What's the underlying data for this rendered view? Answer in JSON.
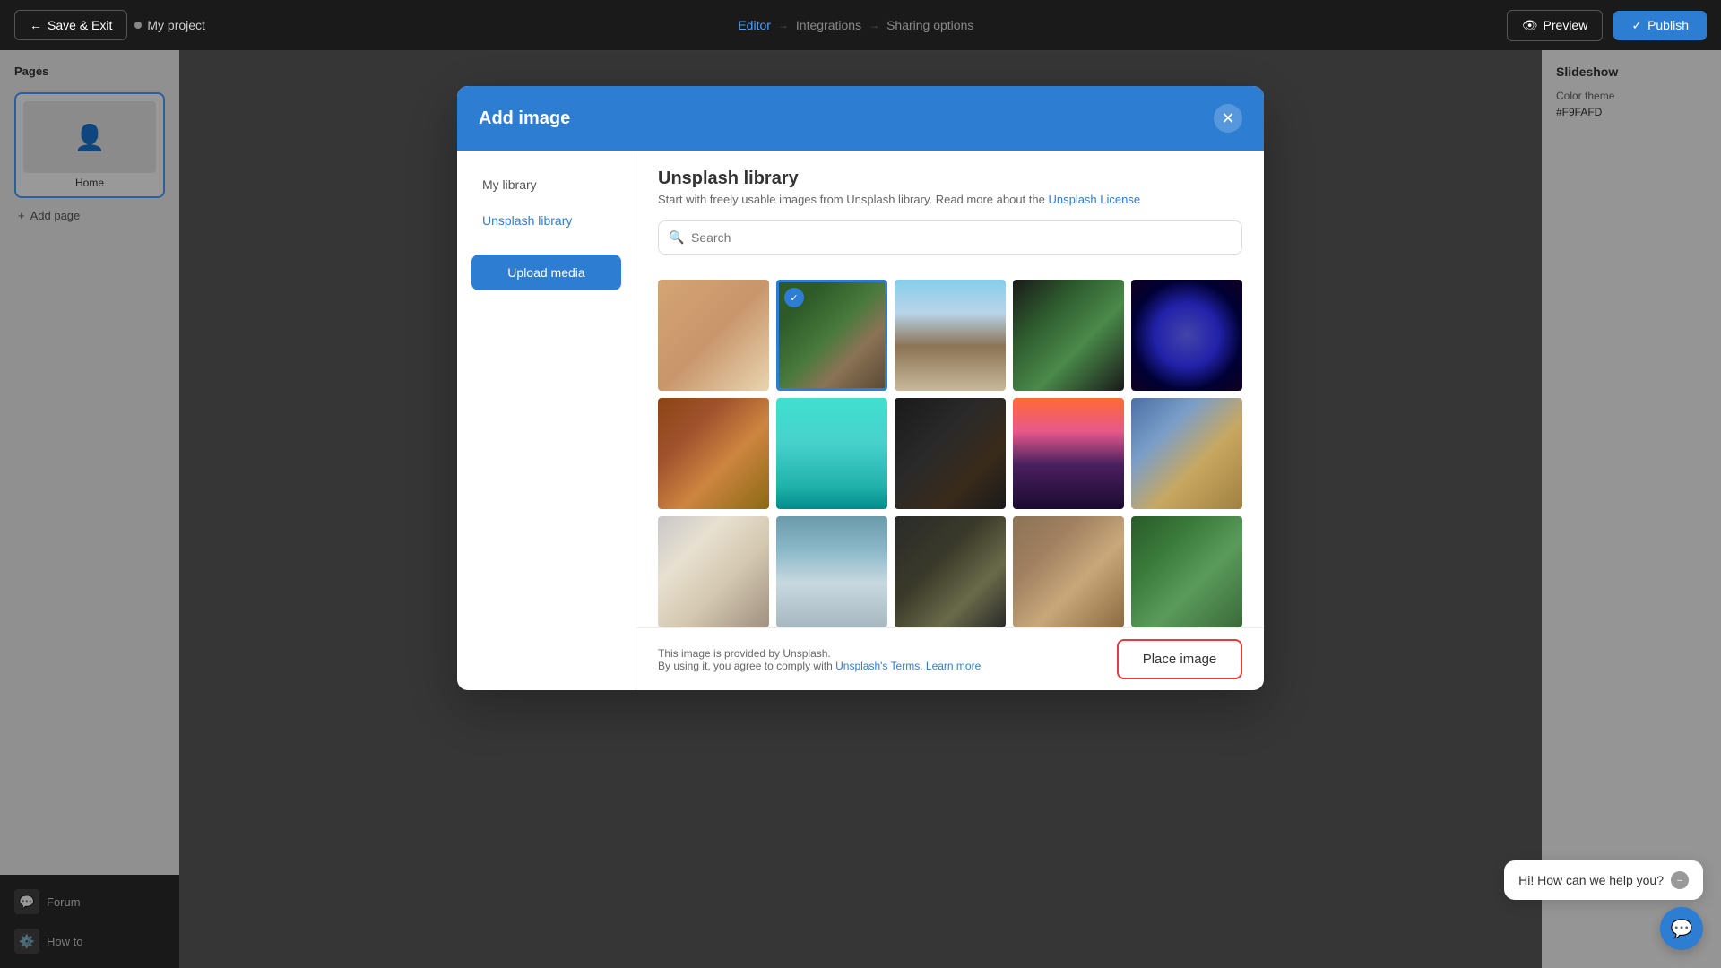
{
  "topnav": {
    "save_exit_label": "Save & Exit",
    "project_name": "My project",
    "editor_label": "Editor",
    "integrations_label": "Integrations",
    "sharing_options_label": "Sharing options",
    "preview_label": "Preview",
    "publish_label": "Publish"
  },
  "left_sidebar": {
    "pages_title": "Pages",
    "page_item_label": "Home",
    "add_page_label": "Add page"
  },
  "right_sidebar": {
    "title": "Slideshow",
    "color_theme_label": "Color theme",
    "color_value": "#F9FAFD"
  },
  "modal": {
    "title": "Add image",
    "nav_items": [
      {
        "id": "my-library",
        "label": "My library",
        "active": false
      },
      {
        "id": "unsplash-library",
        "label": "Unsplash library",
        "active": true
      }
    ],
    "upload_button_label": "Upload media",
    "content": {
      "title": "Unsplash library",
      "subtitle": "Start with freely usable images from Unsplash library. Read more about the",
      "unsplash_link_text": "Unsplash License",
      "search_placeholder": "Search"
    },
    "footer": {
      "line1": "This image is provided by Unsplash.",
      "line2": "By using it, you agree to comply with",
      "terms_link": "Unsplash's Terms.",
      "learn_more": "Learn more",
      "place_image_label": "Place image"
    }
  },
  "chat": {
    "message": "Hi! How can we help you?"
  },
  "bottom_nav": [
    {
      "id": "forum",
      "label": "Forum",
      "icon": "💬"
    },
    {
      "id": "howto",
      "label": "How to",
      "icon": "⚙️"
    }
  ]
}
